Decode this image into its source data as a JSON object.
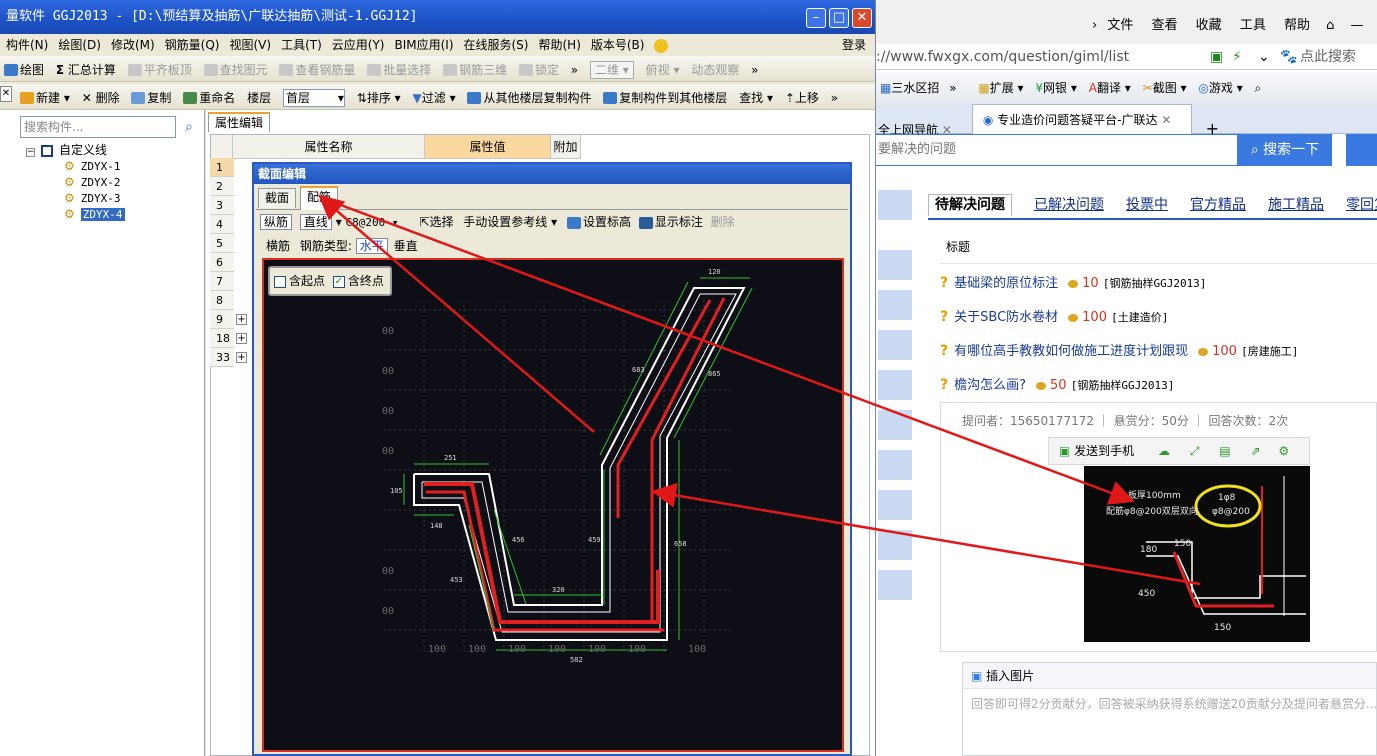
{
  "app": {
    "title": "量软件 GGJ2013 - [D:\\预结算及抽筋\\广联达抽筋\\测试-1.GGJ12]",
    "menu": [
      "构件(N)",
      "绘图(D)",
      "修改(M)",
      "钢筋量(Q)",
      "视图(V)",
      "工具(T)",
      "云应用(Y)",
      "BIM应用(I)",
      "在线服务(S)",
      "帮助(H)",
      "版本号(B)"
    ],
    "login": "登录",
    "toolbar1": [
      "绘图",
      "汇总计算",
      "平齐板顶",
      "查找图元",
      "查看钢筋量",
      "批量选择",
      "钢筋三维",
      "锁定",
      "二维",
      "俯视",
      "动态观察"
    ],
    "toolbar2": {
      "new": "新建",
      "delete": "删除",
      "copy": "复制",
      "rename": "重命名",
      "floor_label": "楼层",
      "floor_value": "首层",
      "sort": "排序",
      "filter": "过滤",
      "copy_from": "从其他楼层复制构件",
      "copy_to": "复制构件到其他楼层",
      "find": "查找",
      "up": "上移"
    },
    "search_placeholder": "搜索构件...",
    "tree": {
      "root": "自定义线",
      "items": [
        "ZDYX-1",
        "ZDYX-2",
        "ZDYX-3",
        "ZDYX-4"
      ],
      "selected": 3
    },
    "prop_tab": "属性编辑",
    "prop_headers": [
      "属性名称",
      "属性值",
      "附加"
    ],
    "rows": [
      "1",
      "2",
      "3",
      "4",
      "5",
      "6",
      "7",
      "8",
      "9",
      "18",
      "33"
    ]
  },
  "dialog": {
    "title": "截面编辑",
    "tabs": [
      "截面",
      "配筋"
    ],
    "toolbar": {
      "long": "纵筋",
      "straight": "直线",
      "spec": "C8@200",
      "select": "选择",
      "manual": "手动设置参考线",
      "set_elev": "设置标高",
      "show_mark": "显示标注",
      "delete": "删除"
    },
    "toolbar2": {
      "cross": "横筋",
      "type_label": "钢筋类型:",
      "horizontal": "水平",
      "vertical": "垂直"
    },
    "checks": {
      "start": "含起点",
      "end": "含终点"
    },
    "dims": {
      "d120": "120",
      "d683": "683",
      "d865": "865",
      "d251": "251",
      "d105": "105",
      "d148": "148",
      "d456": "456",
      "d459": "459",
      "d658": "658",
      "d453": "453",
      "d320": "320",
      "d582": "582",
      "d100": "100",
      "d00": "00"
    }
  },
  "browser": {
    "toolbar": [
      "文件",
      "查看",
      "收藏",
      "工具",
      "帮助"
    ],
    "url": "://www.fwxgx.com/question/giml/list",
    "search_hint": "点此搜索",
    "fav": [
      "三水区招",
      "扩展",
      "网银",
      "翻译",
      "截图",
      "游戏"
    ],
    "tabs": [
      "全上网导航",
      "专业造价问题答疑平台-广联达"
    ],
    "qsearch_placeholder": "要解决的问题",
    "qsearch_btn": "搜索一下",
    "cats": [
      "待解决问题",
      "已解决问题",
      "投票中",
      "官方精品",
      "施工精品",
      "零回复"
    ],
    "col_title": "标题",
    "questions": [
      {
        "t": "基础梁的原位标注",
        "c": "10",
        "tag": "[钢筋抽样GGJ2013]"
      },
      {
        "t": "关于SBC防水卷材",
        "c": "100",
        "tag": "[土建造价]"
      },
      {
        "t": "有哪位高手教教如何做施工进度计划跟现",
        "c": "100",
        "tag": "[房建施工]"
      },
      {
        "t": "檐沟怎么画?",
        "c": "50",
        "tag": "[钢筋抽样GGJ2013]"
      }
    ],
    "meta": "提问者：15650177172 ｜ 悬赏分：50分 ｜ 回答次数：2次",
    "send_phone": "发送到手机",
    "img_labels": {
      "a": "板厚100mm",
      "b": "配筋φ8@200双层双向",
      "c": "1φ8",
      "d": "φ8@200",
      "e": "150",
      "f": "180",
      "g": "450",
      "h": "150"
    },
    "insert_img": "插入图片",
    "answer_placeholder": "回答即可得2分贡献分，回答被采纳获得系统赠送20贡献分及提问者悬赏分..."
  },
  "colors": {
    "accent": "#2f6ae0",
    "rebar": "#e02020",
    "arrow": "#e01818",
    "highlight": "#f0e020"
  }
}
